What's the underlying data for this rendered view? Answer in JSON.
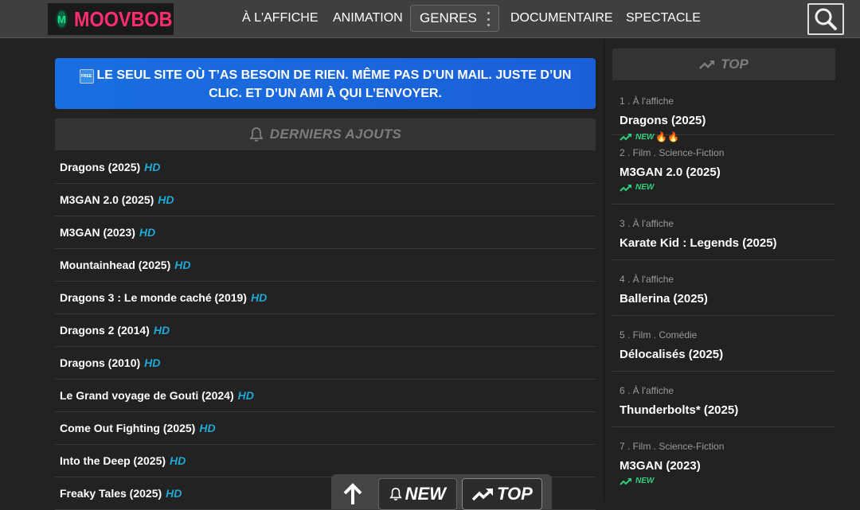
{
  "header": {
    "logo_badge": "M",
    "logo_text": "MOOVBOB",
    "nav": [
      "À L'AFFICHE",
      "ANIMATION",
      "GENRES",
      "DOCUMENTAIRE",
      "SPECTACLE"
    ]
  },
  "banner": {
    "free_badge": "FREE",
    "text": "LE SEUL SITE OÙ T’AS BESOIN DE RIEN. MÊME PAS D’UN MAIL. JUSTE D’UN CLIC. ET D’UN AMI À QUI L’ENVOYER."
  },
  "latest": {
    "title": "DERNIERS AJOUTS",
    "items": [
      {
        "title": "Dragons (2025)",
        "badge": "HD"
      },
      {
        "title": "M3GAN 2.0 (2025)",
        "badge": "HD"
      },
      {
        "title": "M3GAN (2023)",
        "badge": "HD"
      },
      {
        "title": "Mountainhead (2025)",
        "badge": "HD"
      },
      {
        "title": "Dragons 3 : Le monde caché (2019)",
        "badge": "HD"
      },
      {
        "title": "Dragons 2 (2014)",
        "badge": "HD"
      },
      {
        "title": "Dragons (2010)",
        "badge": "HD"
      },
      {
        "title": "Le Grand voyage de Gouti (2024)",
        "badge": "HD"
      },
      {
        "title": "Come Out Fighting (2025)",
        "badge": "HD"
      },
      {
        "title": "Into the Deep (2025)",
        "badge": "HD"
      },
      {
        "title": "Freaky Tales (2025)",
        "badge": "HD"
      }
    ]
  },
  "top": {
    "title": "TOP",
    "items": [
      {
        "category": "1 . À l'affiche",
        "title": "Dragons (2025)",
        "new": "NEW",
        "fire": "🔥🔥"
      },
      {
        "category": "2 . Film . Science-Fiction",
        "title": "M3GAN 2.0 (2025)",
        "new": "NEW",
        "fire": ""
      },
      {
        "category": "3 . À l'affiche",
        "title": "Karate Kid : Legends (2025)",
        "new": "",
        "fire": ""
      },
      {
        "category": "4 . À l'affiche",
        "title": "Ballerina (2025)",
        "new": "",
        "fire": ""
      },
      {
        "category": "5 . Film . Comédie",
        "title": "Délocalisés (2025)",
        "new": "",
        "fire": ""
      },
      {
        "category": "6 . À l'affiche",
        "title": "Thunderbolts* (2025)",
        "new": "",
        "fire": ""
      },
      {
        "category": "7 . Film . Science-Fiction",
        "title": "M3GAN (2023)",
        "new": "NEW",
        "fire": ""
      }
    ]
  },
  "floatbar": {
    "new_label": "NEW",
    "top_label": "TOP"
  },
  "colors": {
    "accent_pink": "#ff2d6f",
    "hd_blue": "#1fa9d6",
    "new_green": "#2fd07a",
    "banner_blue": "#1a6fe0"
  }
}
